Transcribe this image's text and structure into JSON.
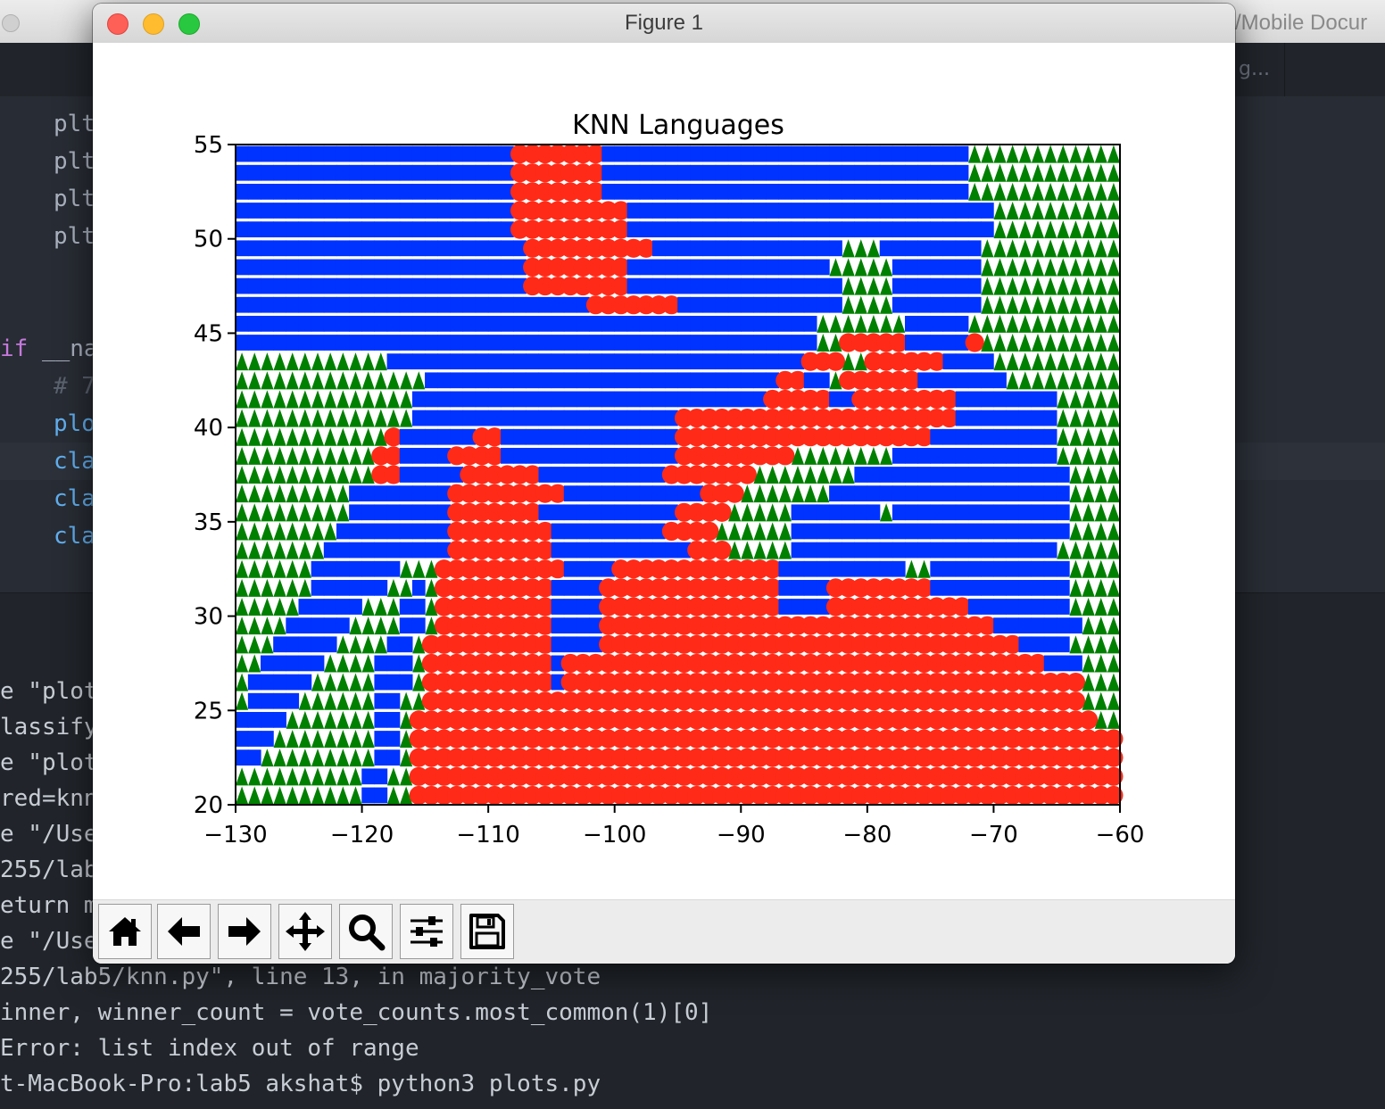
{
  "background_app": {
    "path_fragment": "/Mobile Docur",
    "tab_fragment": "g...",
    "editor_lines": [
      {
        "text": "plt",
        "color": "#abb2bf"
      },
      {
        "text": "plt",
        "color": "#abb2bf"
      },
      {
        "text": "plt",
        "color": "#abb2bf"
      },
      {
        "text": "plt",
        "color": "#abb2bf"
      }
    ],
    "editor_if_keyword": "if",
    "editor_if_rest": " __na",
    "editor_comment": "# 7",
    "editor_lines2": [
      {
        "text": "plo",
        "color": "#61afef"
      },
      {
        "text": "cla",
        "color": "#61afef"
      },
      {
        "text": "cla",
        "color": "#61afef"
      },
      {
        "text": "cla",
        "color": "#61afef"
      }
    ],
    "terminal_lines": [
      "e \"plot",
      "lassify",
      "e \"plot",
      "red=knn",
      "e \"/Use",
      "255/lab",
      "eturn m",
      "e \"/Use",
      "255/lab5/knn.py\", line 13, in majority_vote",
      "inner, winner_count = vote_counts.most_common(1)[0]",
      "Error: list index out of range",
      "t-MacBook-Pro:lab5 akshat$ python3 plots.py"
    ]
  },
  "window": {
    "title": "Figure 1",
    "toolbar": {
      "buttons": [
        {
          "name": "home-button",
          "icon": "home-icon"
        },
        {
          "name": "back-button",
          "icon": "arrow-left-icon"
        },
        {
          "name": "forward-button",
          "icon": "arrow-right-icon"
        },
        {
          "name": "pan-button",
          "icon": "move-icon"
        },
        {
          "name": "zoom-button",
          "icon": "magnifier-icon"
        },
        {
          "name": "configure-subplots-button",
          "icon": "sliders-icon"
        },
        {
          "name": "save-button",
          "icon": "floppy-disk-icon"
        }
      ]
    }
  },
  "chart_data": {
    "type": "scatter",
    "title": "KNN Languages",
    "xlabel": "",
    "ylabel": "",
    "xlim": [
      -130,
      -60
    ],
    "ylim": [
      20,
      55
    ],
    "xticks": [
      -130,
      -120,
      -110,
      -100,
      -90,
      -80,
      -70,
      -60
    ],
    "yticks": [
      20,
      25,
      30,
      35,
      40,
      45,
      50,
      55
    ],
    "grid": false,
    "legend": "none",
    "grid_points": {
      "x_start": -130,
      "x_step": 1,
      "count_x": 70,
      "y_start": 20,
      "y_step": 1,
      "count_y": 35
    },
    "series": [
      {
        "marker": "square",
        "color": "#0033ff"
      },
      {
        "marker": "circle",
        "color": "#ff2a17"
      },
      {
        "marker": "triangle",
        "color": "#008000"
      }
    ],
    "rows_encoding": "B = blue square, R = red circle, G = green triangle; each row string lists grid x = -130..-61 step 1; rows listed from y = 20 upward",
    "rows": [
      "GGGGGGGGGGBBGGRRRRRRRRRRRRRRRRRRRRRRRRRRRRRRRRRRRRRRRRRRRRRRRRRRRRRRRR",
      "GGGGGGGGGGBBGGRRRRRRRRRRRRRRRRRRRRRRRRRRRRRRRRRRRRRRRRRRRRRRRRRRRRRRRR",
      "BBGGGGGGGGGBBGRRRRRRRRRRRRRRRRRRRRRRRRRRRRRRRRRRRRRRRRRRRRRRRRRRRRRRRR",
      "BBBGGGGGGGGBBGRRRRRRRRRRRRRRRRRRRRRRRRRRRRRRRRRRRRRRRRRRRRRRRRRRRRRRRR",
      "BBBBGGGGGGGBBGRRRRRRRRRRRRRRRRRRRRRRRRRRRRRRRRRRRRRRRRRRRRRRRRRRRRRRGG",
      "GBBBBGGGGGGBBGGRRRRRRRRRRRRRRRRRRRRRRRRRRRRRRRRRRRRRRRRRRRRRRRRRRRRGGG",
      "GBBBBBGGGGGBBBGRRRRRRRRRRBRRRRRRRRRRRRRRRRRRRRRRRRRRRRRRRRRRRRRRRRRGGG",
      "GGBBBBBGGGGBBBGRRRRRRRRRRBRRRRRRRRRRRRRRRRRRRRRRRRRRRRRRRRRRRRRRBBBGGG",
      "GGGBBBBBGGGGBBGRRRRRRRRRRBBBBRRRRRRRRRRRRRRRRRRRRRRRRRRRRRRRRRBBBBGGGG",
      "GGGGBBBBBGGGGBBGRRRRRRRRRBBBBRRRRRRRRRRRRRRRRRRRRRRRRRRRRRRRBBBBBBBGGG",
      "GGGGGBBBBBGGGBBGRRRRRRRRRBBBBRRRRRRRRRRRRRRBBBBRRRRRRRRRRRBBBBBBBBGGGG",
      "GGGGGGBBBBBBGGBGRRRRRRRRRBBBBRRRRRRRRRRRRRRBBBBRRRRRRRRBBBBBBBBBBBGGGG",
      "GGGGGGBBBBBBBGGGRRRRRRRRRRBBBBRRRRRRRRRRRRRBBBBBBBBBBGGBBBBBBBBBBBGGGG",
      "GGGGGGGBBBBBBBBBBRRRRRRRRBBBBBBBBBBBRRRGGGGGBBBBBBBBBBBBBBBBBBBBBGGGGG",
      "GGGGGGGGBBBBBBBBBRRRRRRRRBBBBBBBBBRRRRGGGGGGBBBBBBBBBBBBBBBBBBBBBBGGGG",
      "GGGGGGGGGBBBBBBBBRRRRRRRBBBBBBBBBBBRRRRGGGGGBBBBBBBGBBBBBBBBBBBBBBGGGG",
      "GGGGGGGGGBBBBBBBBRRRRRRRRRBBBBBBBBBBBRRRGGGGGGGBBBBBBBBBBBBBBBBBBBGGGG",
      "GGGGGGGGGGGRRBBBBBRRRRRRBBBBBBBBBBRRRRRRRGGGGGGGGBBBBBBBBBBBBBBBBBGGGG",
      "GGGGGGGGGGGRRBBBBRRRRBBBBBBBBBBBBBBRRRRRRRRRGGGGGGGGBBBBBBBBBBBBBGGGGG",
      "GGGGGGGGGGGGRBBBBBBRRBBBBBBBBBBBBBBRRRRRRRRRRRRRRRRRRRRBBBBBBBBBBGGGGG",
      "GGGGGGGGGGGGGGBBBBBBBBBBBBBBBBBBBBBRRRRRRRRRRRRRRRRRRRRRRBBBBBBBBGGGGG",
      "GGGGGGGGGGGGGGBBBBBBBBBBBBBBBBBBBBBBBBBBBBRRRRRBBRRRRRRRRBBBBBBBBGGGGG",
      "GGGGGGGGGGGGGGGBBBBBBBBBBBBBBBBBBBBBBBBBBBBRRBBGRRRRRRBBBBBBBGGGGGGGGG",
      "GGGGGGGGGGGGBBBBBBBBBBBBBBBBBBBBBBBBBBBBBBBBBRRRGGRRRRRRBBBBGGGGGGGGGG",
      "BBBBBBBBBBBBBBBBBBBBBBBBBBBBBBBBBBBBBBBBBBBBBBGGRRRRRBBBBBRGGGGGGGGGGG",
      "BBBBBBBBBBBBBBBBBBBBBBBBBBBBBBBBBBBBBBBBBBBBBBGGGGGGGBBBBBGGGGGGGGGGGG",
      "BBBBBBBBBBBBBBBBBBBBBBBBBBBBRRRRRRRBBBBBBBBBBBBBGGGGBBBBBBBGGGGGGGGGGG",
      "BBBBBBBBBBBBBBBBBBBBBBBRRRRRRRRBBBBBBBBBBBBBBBBBGGGGBBBBBBBGGGGGGGGGGG",
      "BBBBBBBBBBBBBBBBBBBBBBBRRRRRRRRBBBBBBBBBBBBBBBBGGGGGBBBBBBBGGGGGGGGGGG",
      "BBBBBBBBBBBBBBBBBBBBBBBRRRRRRRRRRBBBBBBBBBBBBBBBGGGBBBBBBBBGGGGGGGGGGG",
      "BBBBBBBBBBBBBBBBBBBBBBRRRRRRRRRBBBBBBBBBBBBBBBBBBBBBBBBBBBBBGGGGGGGGGG",
      "BBBBBBBBBBBBBBBBBBBBBBRRRRRRRRRBBBBBBBBBBBBBBBBBBBBBBBBBBBBBGGGGGGGGGG",
      "BBBBBBBBBBBBBBBBBBBBBBRRRRRRRBBBBBBBBBBBBBBBBBBBBBBBBBBBBBGGGGGGGGGGGG",
      "BBBBBBBBBBBBBBBBBBBBBBRRRRRRRBBBBBBBBBBBBBBBBBBBBBBBBBBBBBGGGGGGGGGGGG",
      "BBBBBBBBBBBBBBBBBBBBBBRRRRRRRBBBBBBBBBBBBBBBBBBBBBBBBBBBBBGGGGGGGGGGGG"
    ]
  }
}
